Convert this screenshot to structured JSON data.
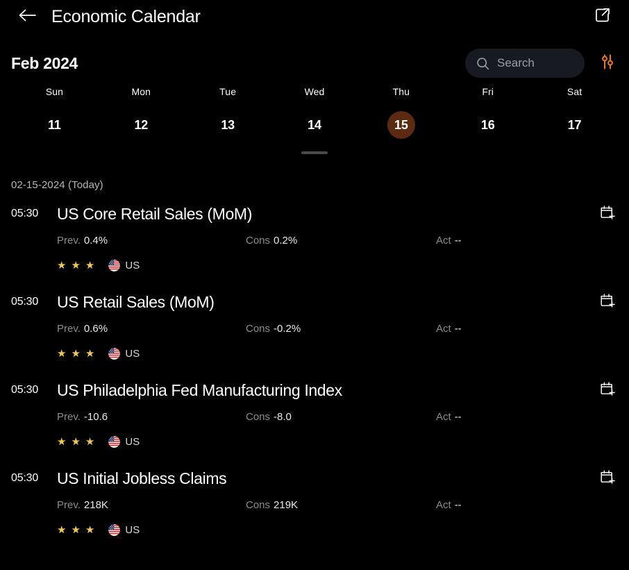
{
  "navbar": {
    "back_icon": "arrow-left-icon",
    "title": "Economic Calendar",
    "share_icon": "share-icon"
  },
  "toolbar": {
    "month_label": "Feb 2024",
    "search_placeholder": "Search",
    "search_value": "",
    "search_icon": "search-icon",
    "filter_icon": "sliders-filter-icon"
  },
  "week_strip": {
    "days": [
      {
        "name": "Sun",
        "num": "11",
        "selected": false
      },
      {
        "name": "Mon",
        "num": "12",
        "selected": false
      },
      {
        "name": "Tue",
        "num": "13",
        "selected": false
      },
      {
        "name": "Wed",
        "num": "14",
        "selected": false
      },
      {
        "name": "Thu",
        "num": "15",
        "selected": true
      },
      {
        "name": "Fri",
        "num": "16",
        "selected": false
      },
      {
        "name": "Sat",
        "num": "17",
        "selected": false
      }
    ],
    "selected_bg": "#5b2a10"
  },
  "section": {
    "date_label": "02-15-2024 (Today)"
  },
  "labels": {
    "prev": "Prev.",
    "cons": "Cons",
    "act": "Act"
  },
  "events": [
    {
      "time": "05:30",
      "title": "US Core Retail Sales (MoM)",
      "prev": "0.4%",
      "cons": "0.2%",
      "act": "--",
      "importance": 3,
      "country": "US",
      "add_icon": "calendar-add-icon"
    },
    {
      "time": "05:30",
      "title": "US Retail Sales (MoM)",
      "prev": "0.6%",
      "cons": "-0.2%",
      "act": "--",
      "importance": 3,
      "country": "US",
      "add_icon": "calendar-add-icon"
    },
    {
      "time": "05:30",
      "title": "US Philadelphia Fed Manufacturing Index",
      "prev": "-10.6",
      "cons": "-8.0",
      "act": "--",
      "importance": 3,
      "country": "US",
      "add_icon": "calendar-add-icon"
    },
    {
      "time": "05:30",
      "title": "US Initial Jobless Claims",
      "prev": "218K",
      "cons": "219K",
      "act": "--",
      "importance": 3,
      "country": "US",
      "add_icon": "calendar-add-icon"
    }
  ],
  "colors": {
    "background": "#000000",
    "accent": "#ee7623",
    "star": "#f2c94c",
    "search_bg": "#171a20"
  }
}
